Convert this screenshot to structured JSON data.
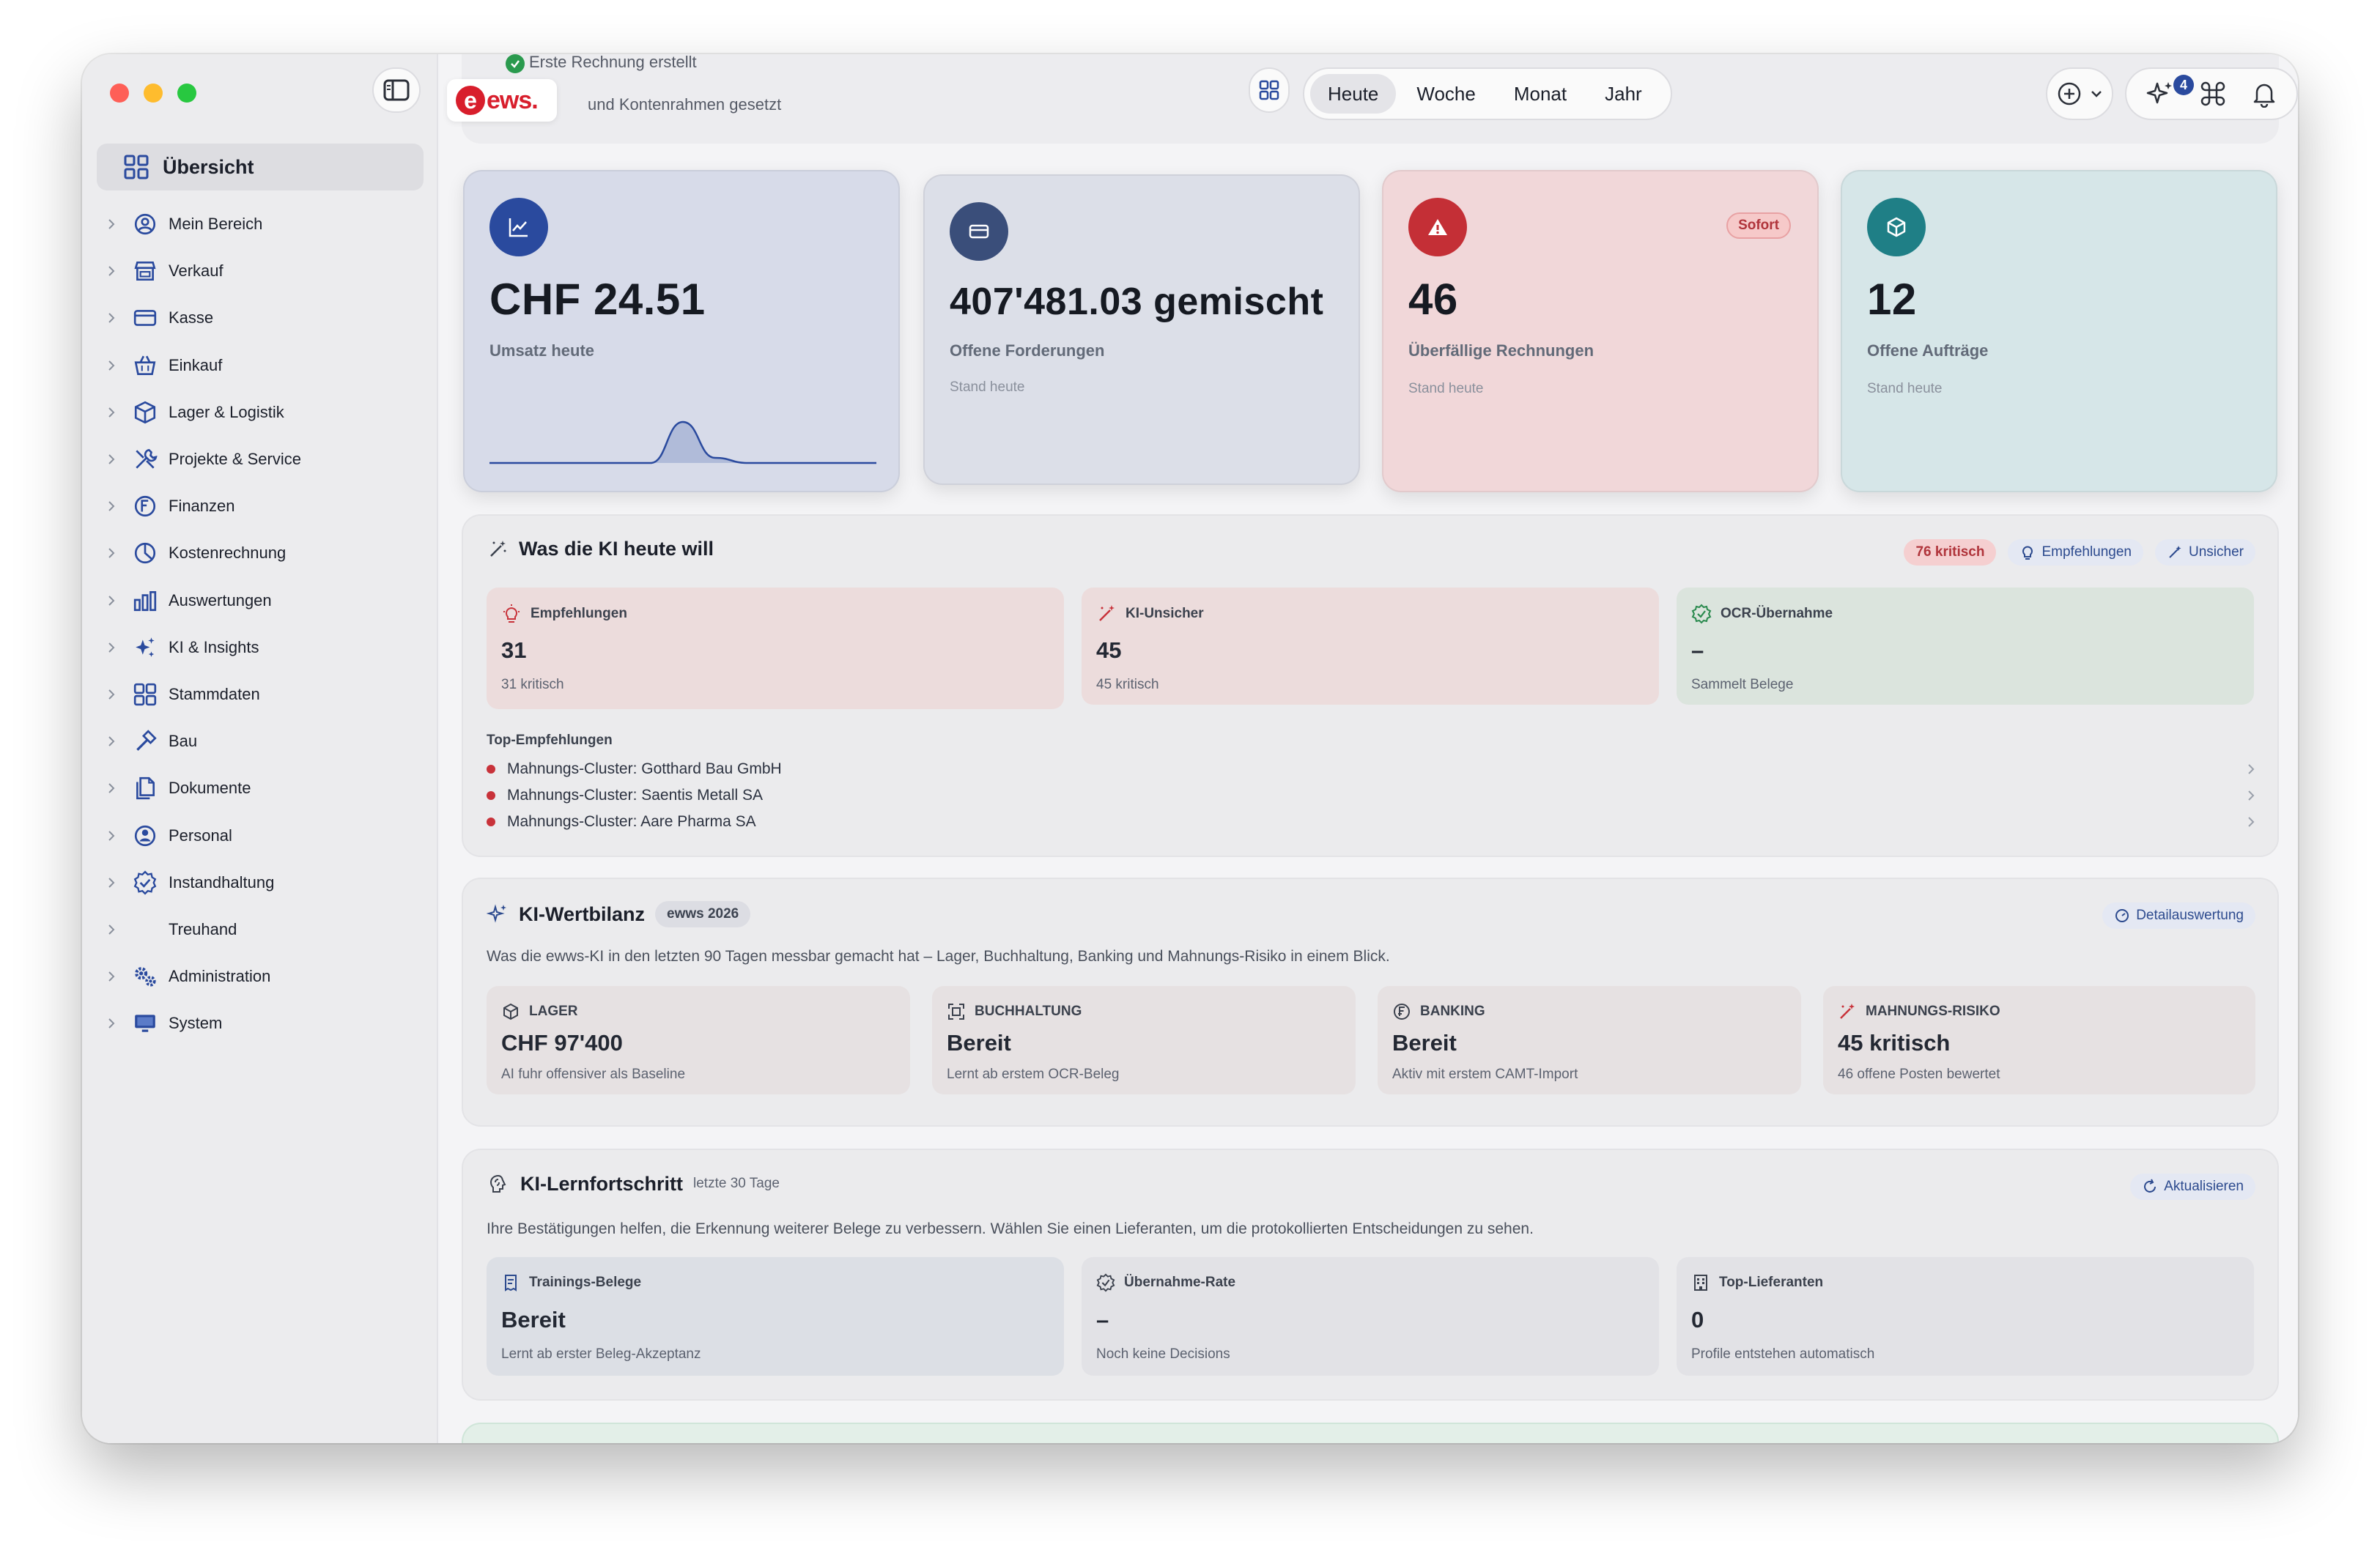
{
  "colors": {
    "accent_blue": "#2a4a9e",
    "red": "#c8323a",
    "teal": "#1f7f86",
    "kpi_blue_bg": "#d7dbe9",
    "kpi_red_bg": "#f1d7d9",
    "kpi_teal_bg": "#d6e6e8"
  },
  "sidebar": {
    "overview_label": "Übersicht",
    "items": [
      {
        "label": "Mein Bereich",
        "icon": "user-circle-icon"
      },
      {
        "label": "Verkauf",
        "icon": "storefront-icon"
      },
      {
        "label": "Kasse",
        "icon": "card-icon"
      },
      {
        "label": "Einkauf",
        "icon": "basket-icon"
      },
      {
        "label": "Lager & Logistik",
        "icon": "box-icon"
      },
      {
        "label": "Projekte & Service",
        "icon": "tools-icon"
      },
      {
        "label": "Finanzen",
        "icon": "franc-icon"
      },
      {
        "label": "Kostenrechnung",
        "icon": "pie-icon"
      },
      {
        "label": "Auswertungen",
        "icon": "bar-chart-icon"
      },
      {
        "label": "KI & Insights",
        "icon": "sparkles-icon"
      },
      {
        "label": "Stammdaten",
        "icon": "grid-icon"
      },
      {
        "label": "Bau",
        "icon": "hammer-icon"
      },
      {
        "label": "Dokumente",
        "icon": "documents-icon"
      },
      {
        "label": "Personal",
        "icon": "person-icon"
      },
      {
        "label": "Instandhaltung",
        "icon": "badge-check-icon"
      },
      {
        "label": "Treuhand",
        "icon": "handshake-icon"
      },
      {
        "label": "Administration",
        "icon": "gears-icon"
      },
      {
        "label": "System",
        "icon": "monitor-icon"
      }
    ]
  },
  "topbar": {
    "activity_line1": "Erste Rechnung erstellt",
    "activity_line2": "und Kontenrahmen gesetzt",
    "logo_text": "ews.",
    "periods": [
      "Heute",
      "Woche",
      "Monat",
      "Jahr"
    ],
    "active_period": "Heute",
    "ai_badge_count": "4"
  },
  "kpis": [
    {
      "value": "CHF 24.51",
      "label": "Umsatz heute",
      "icon": "chart-line-icon",
      "stand": ""
    },
    {
      "value": "407'481.03 gemischt",
      "label": "Offene Forderungen",
      "icon": "credit-card-icon",
      "stand": "Stand heute"
    },
    {
      "value": "46",
      "label": "Überfällige Rechnungen",
      "icon": "warning-icon",
      "stand": "Stand heute",
      "badge": "Sofort"
    },
    {
      "value": "12",
      "label": "Offene Aufträge",
      "icon": "cube-icon",
      "stand": "Stand heute"
    }
  ],
  "sparkline": {
    "values": [
      0,
      0,
      0,
      0,
      0,
      0,
      0.8,
      0.1,
      0,
      0,
      0,
      0,
      0
    ]
  },
  "ki_heute": {
    "title": "Was die KI heute will",
    "chips": {
      "critical": "76 kritisch",
      "recommendations": "Empfehlungen",
      "uncertain": "Unsicher"
    },
    "tiles": [
      {
        "head": "Empfehlungen",
        "value": "31",
        "sub": "31 kritisch"
      },
      {
        "head": "KI-Unsicher",
        "value": "45",
        "sub": "45 kritisch"
      },
      {
        "head": "OCR-Übernahme",
        "value": "–",
        "sub": "Sammelt Belege"
      }
    ],
    "top_heading": "Top-Empfehlungen",
    "top_items": [
      "Mahnungs-Cluster: Gotthard Bau GmbH",
      "Mahnungs-Cluster: Saentis Metall SA",
      "Mahnungs-Cluster: Aare Pharma SA"
    ]
  },
  "wertbilanz": {
    "title": "KI-Wertbilanz",
    "chip": "ewws 2026",
    "detail_button": "Detailauswertung",
    "desc": "Was die ewws-KI in den letzten 90 Tagen messbar gemacht hat – Lager, Buchhaltung, Banking und Mahnungs-Risiko in einem Blick.",
    "tiles": [
      {
        "head": "LAGER",
        "value": "CHF 97'400",
        "sub": "AI fuhr offensiver als Baseline"
      },
      {
        "head": "BUCHHALTUNG",
        "value": "Bereit",
        "sub": "Lernt ab erstem OCR-Beleg"
      },
      {
        "head": "BANKING",
        "value": "Bereit",
        "sub": "Aktiv mit erstem CAMT-Import"
      },
      {
        "head": "MAHNUNGS-RISIKO",
        "value": "45 kritisch",
        "sub": "46 offene Posten bewertet"
      }
    ]
  },
  "lernfortschritt": {
    "title": "KI-Lernfortschritt",
    "chip": "letzte 30 Tage",
    "refresh_button": "Aktualisieren",
    "desc": "Ihre Bestätigungen helfen, die Erkennung weiterer Belege zu verbessern. Wählen Sie einen Lieferanten, um die protokollierten Entscheidungen zu sehen.",
    "tiles": [
      {
        "head": "Trainings-Belege",
        "value": "Bereit",
        "sub": "Lernt ab erster Beleg-Akzeptanz"
      },
      {
        "head": "Übernahme-Rate",
        "value": "–",
        "sub": "Noch keine Decisions"
      },
      {
        "head": "Top-Lieferanten",
        "value": "0",
        "sub": "Profile entstehen automatisch"
      }
    ]
  }
}
